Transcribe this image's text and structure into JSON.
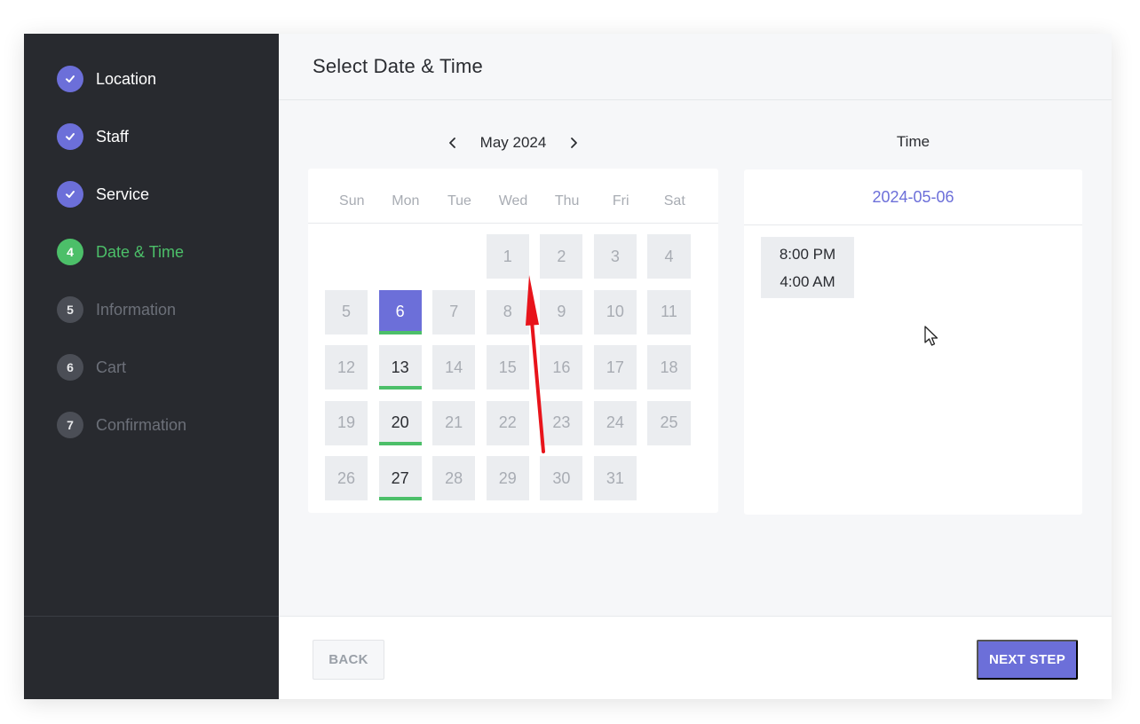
{
  "sidebar": {
    "steps": [
      {
        "number": "1",
        "label": "Location",
        "state": "done"
      },
      {
        "number": "2",
        "label": "Staff",
        "state": "done"
      },
      {
        "number": "3",
        "label": "Service",
        "state": "done"
      },
      {
        "number": "4",
        "label": "Date & Time",
        "state": "current"
      },
      {
        "number": "5",
        "label": "Information",
        "state": "pending"
      },
      {
        "number": "6",
        "label": "Cart",
        "state": "pending"
      },
      {
        "number": "7",
        "label": "Confirmation",
        "state": "pending"
      }
    ]
  },
  "header": {
    "title": "Select Date & Time"
  },
  "calendar": {
    "month_label": "May 2024",
    "prev_icon": "chevron-left-icon",
    "next_icon": "chevron-right-icon",
    "weekdays": [
      "Sun",
      "Mon",
      "Tue",
      "Wed",
      "Thu",
      "Fri",
      "Sat"
    ],
    "weeks": [
      [
        "",
        "",
        "",
        "1",
        "2",
        "3",
        "4"
      ],
      [
        "5",
        "6",
        "7",
        "8",
        "9",
        "10",
        "11"
      ],
      [
        "12",
        "13",
        "14",
        "15",
        "16",
        "17",
        "18"
      ],
      [
        "19",
        "20",
        "21",
        "22",
        "23",
        "24",
        "25"
      ],
      [
        "26",
        "27",
        "28",
        "29",
        "30",
        "31",
        ""
      ]
    ],
    "available_days": [
      "6",
      "13",
      "20",
      "27"
    ],
    "selected_day": "6"
  },
  "time_panel": {
    "heading": "Time",
    "selected_date": "2024-05-06",
    "slots": [
      "8:00 PM",
      "4:00 AM"
    ]
  },
  "footer": {
    "back_label": "BACK",
    "next_label": "NEXT STEP"
  },
  "colors": {
    "accent": "#6c6fd9",
    "success": "#4cbf69",
    "sidebar_bg": "#282a2f",
    "annotation_arrow": "#e8141b"
  }
}
